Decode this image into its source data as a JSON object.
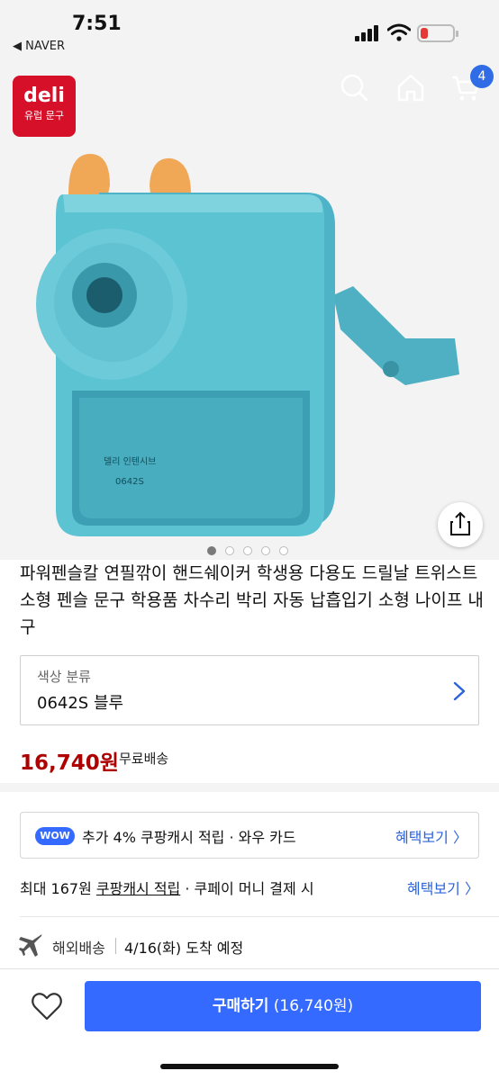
{
  "status_bar": {
    "time": "7:51",
    "back_app": "◀ NAVER",
    "icons": [
      "signal-icon",
      "wifi-icon",
      "battery-low-icon"
    ]
  },
  "header": {
    "brand_logo": {
      "name": "deli",
      "sub": "유럽 문구",
      "color": "#d7102a"
    },
    "icons": [
      "search-icon",
      "home-icon",
      "cart-icon"
    ],
    "cart_count": "4",
    "accent": "#2f6ce5"
  },
  "gallery": {
    "image_alt": "sky-blue hand-crank pencil sharpener with orange ears",
    "product_colors": {
      "body": "#59bfd0",
      "ears": "#f0a857",
      "bg": "#f3f3f3"
    },
    "sharpener_label_line1": "델리 인텐시브",
    "sharpener_label_line2": "0642S",
    "dots_count": 5,
    "active_dot": 0,
    "share_icon": "share-icon"
  },
  "product": {
    "title": "파워펜슬칼 연필깎이 핸드쉐이커 학생용 다용도 드릴날 트위스트 소형 펜슬 문구 학용품 차수리 박리 자동 납흡입기 소형 나이프 내구"
  },
  "option": {
    "label": "색상 분류",
    "value": "0642S 블루",
    "icon": "chevron-right-icon"
  },
  "price": {
    "amount": "16,740원",
    "shipping": "무료배송",
    "color": "#ae0000"
  },
  "benefits": {
    "wow_badge": "WOW",
    "wow_text": "추가 4% 쿠팡캐시 적립 · 와우 카드",
    "wow_link": "혜택보기 〉",
    "cash_prefix": "최대 167원 ",
    "cash_underlined": "쿠팡캐시 적립",
    "cash_suffix": " · 쿠페이 머니 결제 시",
    "cash_link": "혜택보기 〉"
  },
  "delivery": {
    "icon": "airplane-icon",
    "type": "해외배송",
    "date": "4/16(화) 도착 예정"
  },
  "bottom_bar": {
    "heart_icon": "heart-icon",
    "buy_label": "구매하기",
    "buy_price": "(16,740원)",
    "buy_color": "#346aff"
  }
}
